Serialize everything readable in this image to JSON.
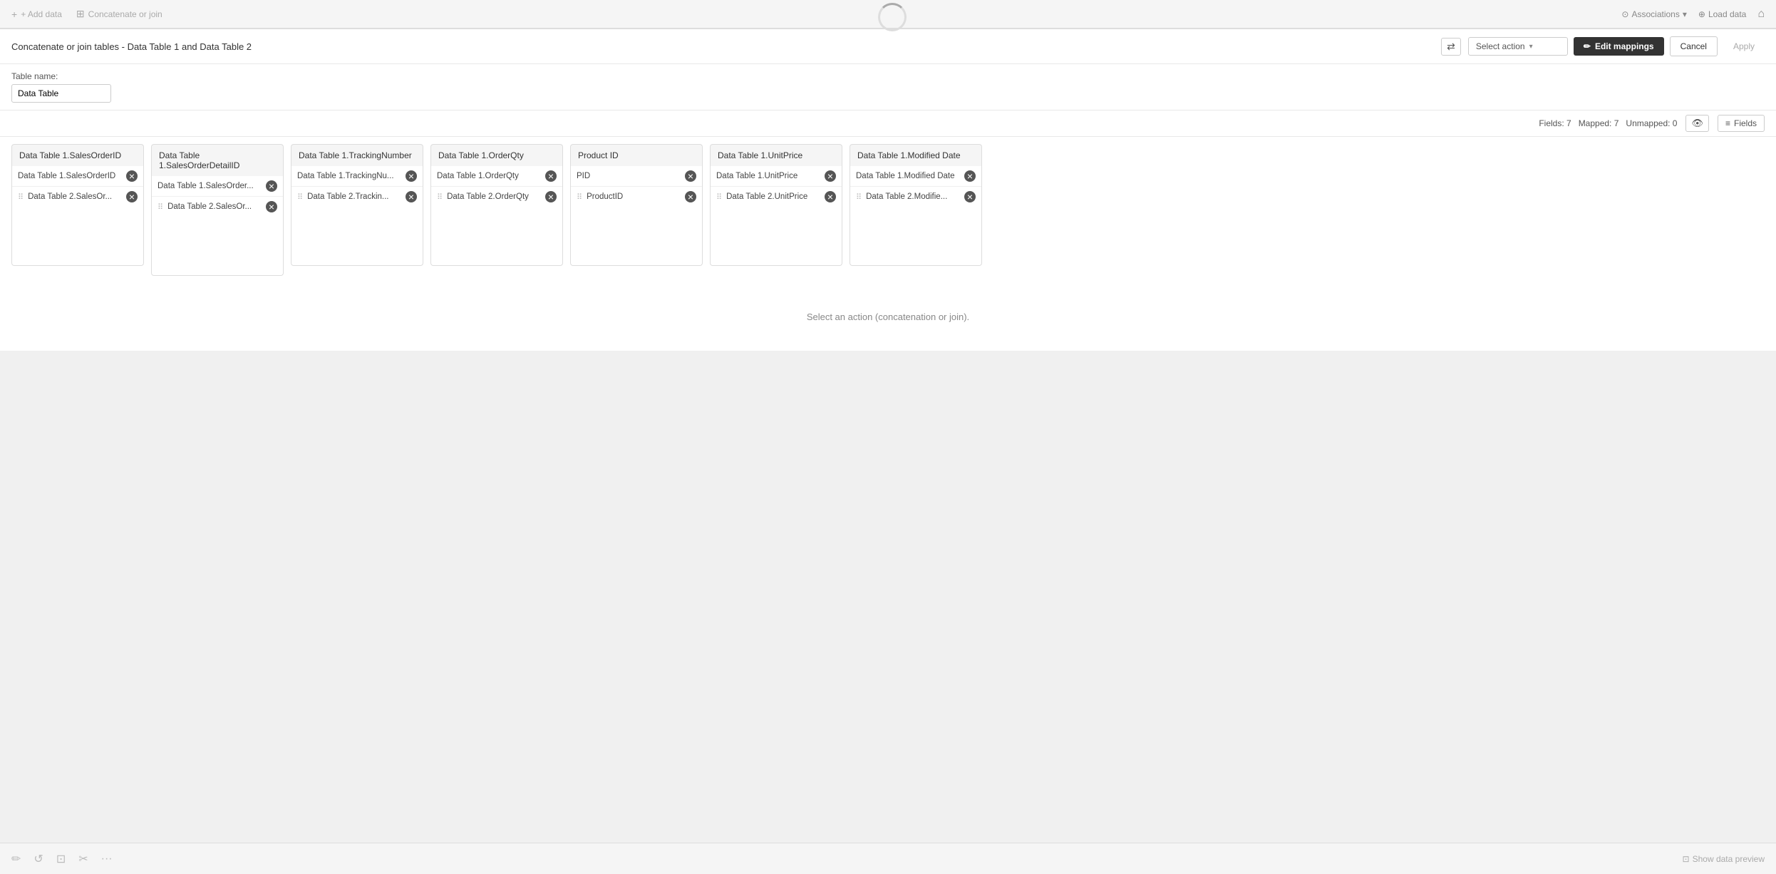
{
  "topToolbar": {
    "addData": "+ Add data",
    "concatenateOrJoin": "Concatenate or join",
    "associations": "Associations",
    "loadData": "Load data",
    "homeIcon": "⌂"
  },
  "panelHeader": {
    "title": "Concatenate or join tables - Data Table 1 and Data Table 2",
    "swapIcon": "⇄",
    "selectActionLabel": "Select action",
    "editMappingsLabel": "Edit mappings",
    "editMappingsIcon": "✏",
    "cancelLabel": "Cancel",
    "applyLabel": "Apply"
  },
  "tableNameSection": {
    "label": "Table name:",
    "value": "Data Table"
  },
  "fieldsBar": {
    "fieldsCount": "Fields: 7",
    "mappedCount": "Mapped: 7",
    "unmappedCount": "Unmapped: 0",
    "eyeIcon": "👁",
    "fieldsLabel": "Fields",
    "listIcon": "≡"
  },
  "columns": [
    {
      "header": "Data Table 1.SalesOrderID",
      "row1": {
        "text": "Data Table 1.SalesOrderID",
        "hasRemove": true
      },
      "row2": {
        "text": "Data Table 2.SalesOr...",
        "hasRemove": true,
        "hasDrag": true
      }
    },
    {
      "header": "Data Table 1.SalesOrderDetailID",
      "row1": {
        "text": "Data Table 1.SalesOrder...",
        "hasRemove": true
      },
      "row2": {
        "text": "Data Table 2.SalesOr...",
        "hasRemove": true,
        "hasDrag": true
      }
    },
    {
      "header": "Data Table 1.TrackingNumber",
      "row1": {
        "text": "Data Table 1.TrackingNu...",
        "hasRemove": true
      },
      "row2": {
        "text": "Data Table 2.Trackin...",
        "hasRemove": true,
        "hasDrag": true
      }
    },
    {
      "header": "Data Table 1.OrderQty",
      "row1": {
        "text": "Data Table 1.OrderQty",
        "hasRemove": true
      },
      "row2": {
        "text": "Data Table 2.OrderQty",
        "hasRemove": true,
        "hasDrag": true
      }
    },
    {
      "header": "Product ID",
      "row1": {
        "text": "PID",
        "hasRemove": true
      },
      "row2": {
        "text": "ProductID",
        "hasRemove": true,
        "hasDrag": true
      }
    },
    {
      "header": "Data Table 1.UnitPrice",
      "row1": {
        "text": "Data Table 1.UnitPrice",
        "hasRemove": true
      },
      "row2": {
        "text": "Data Table 2.UnitPrice",
        "hasRemove": true,
        "hasDrag": true
      }
    },
    {
      "header": "Data Table 1.Modified Date",
      "row1": {
        "text": "Data Table 1.Modified Date",
        "hasRemove": true
      },
      "row2": {
        "text": "Data Table 2.Modifie...",
        "hasRemove": true,
        "hasDrag": true
      }
    }
  ],
  "bottomMessage": "Select an action (concatenation or join).",
  "bottomToolbar": {
    "tools": [
      "✏",
      "↺",
      "⊡",
      "✂",
      "···"
    ],
    "showDataPreview": "Show data preview",
    "showDataIcon": "⊡"
  }
}
